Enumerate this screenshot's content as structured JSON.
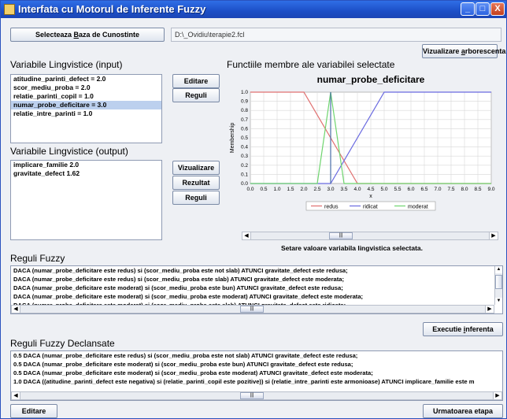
{
  "window": {
    "title": "Interfata cu Motorul de Inferente Fuzzy",
    "buttons": {
      "minimize": "_",
      "maximize": "□",
      "close": "X"
    }
  },
  "kb": {
    "select_prefix": "Selecteaza ",
    "select_underlined": "B",
    "select_suffix": "aza de Cunostinte",
    "path": "D:\\_Ovidiu\\terapie2.fcl"
  },
  "tree_button": {
    "prefix": "Vizualizare ",
    "underlined": "a",
    "suffix": "rborescenta"
  },
  "input_section": {
    "title": "Variabile Lingvistice (input)",
    "items": [
      "atitudine_parinti_defect = 2.0",
      "scor_mediu_proba = 2.0",
      "relatie_parinti_copil = 1.0",
      "numar_probe_deficitare = 3.0",
      "relatie_intre_parinti = 1.0"
    ],
    "selected_index": 3,
    "edit_label": "Editare",
    "rules_label": "Reguli"
  },
  "output_section": {
    "title": "Variabile Lingvistice (output)",
    "items": [
      "implicare_familie 2.0",
      "gravitate_defect 1.62"
    ],
    "view_label": "Vizualizare",
    "result_label": "Rezultat",
    "rules_label": "Reguli"
  },
  "chart_section": {
    "title": "Functiile membre ale variabilei selectate",
    "status": "Setare valoare variabila lingvistica selectata.",
    "scroll_thumb": "|||"
  },
  "chart_data": {
    "type": "line",
    "title": "numar_probe_deficitare",
    "xlabel": "x",
    "ylabel": "Membership",
    "xlim": [
      0,
      9
    ],
    "ylim": [
      0,
      1
    ],
    "x_ticks": [
      "0.0",
      "0.5",
      "1.0",
      "1.5",
      "2.0",
      "2.5",
      "3.0",
      "3.5",
      "4.0",
      "4.5",
      "5.0",
      "5.5",
      "6.0",
      "6.5",
      "7.0",
      "7.5",
      "8.0",
      "8.5",
      "9.0"
    ],
    "y_ticks": [
      "0.0",
      "0.1",
      "0.2",
      "0.3",
      "0.4",
      "0.5",
      "0.6",
      "0.7",
      "0.8",
      "0.9",
      "1.0"
    ],
    "marker_x": 3.0,
    "grid": true,
    "legend_position": "bottom",
    "series": [
      {
        "name": "redus",
        "color": "#e07070",
        "x": [
          0,
          2,
          4,
          9
        ],
        "y": [
          1,
          1,
          0,
          0
        ]
      },
      {
        "name": "ridicat",
        "color": "#6a6ae0",
        "x": [
          0,
          3,
          5,
          9
        ],
        "y": [
          0,
          0,
          1,
          1
        ]
      },
      {
        "name": "moderat",
        "color": "#6fd56f",
        "x": [
          0,
          2.5,
          3,
          3.5,
          9
        ],
        "y": [
          0,
          0,
          1,
          0,
          0
        ]
      }
    ]
  },
  "fuzzy_rules": {
    "title": "Reguli Fuzzy",
    "lines": [
      "DACA (numar_probe_deficitare este redus) si (scor_mediu_proba  este not slab) ATUNCI gravitate_defect este redusa;",
      "DACA (numar_probe_deficitare este redus) si (scor_mediu_proba este slab) ATUNCI gravitate_defect este moderata;",
      "DACA (numar_probe_deficitare este moderat) si (scor_mediu_proba este bun) ATUNCI gravitate_defect este redusa;",
      "DACA (numar_probe_deficitare este moderat) si (scor_mediu_proba este moderat) ATUNCI gravitate_defect este moderata;",
      "DACA (numar_probe_deficitare este moderat) si (scor_mediu_proba este slab) ATUNCI gravitate_defect este ridicata;"
    ],
    "scroll_thumb": "|||",
    "exec_prefix": "Executie ",
    "exec_underlined": "i",
    "exec_suffix": "nferenta"
  },
  "fired_rules": {
    "title": "Reguli Fuzzy Declansate",
    "lines": [
      "0.5 DACA (numar_probe_deficitare este redus) si (scor_mediu_proba  este not slab) ATUNCI gravitate_defect este redusa;",
      "0.5 DACA (numar_probe_deficitare este moderat) si (scor_mediu_proba este bun) ATUNCI gravitate_defect este redusa;",
      "0.5 DACA (numar_probe_deficitare este moderat) si (scor_mediu_proba este moderat) ATUNCI gravitate_defect este moderata;",
      "1.0 DACA ((atitudine_parinti_defect este negativa) si (relatie_parinti_copil este pozitive)) si (relatie_intre_parinti este armonioase) ATUNCI implicare_familie este m"
    ],
    "scroll_thumb": "|||"
  },
  "bottom": {
    "edit_label": "Editare",
    "next_label": "Urmatoarea etapa"
  }
}
